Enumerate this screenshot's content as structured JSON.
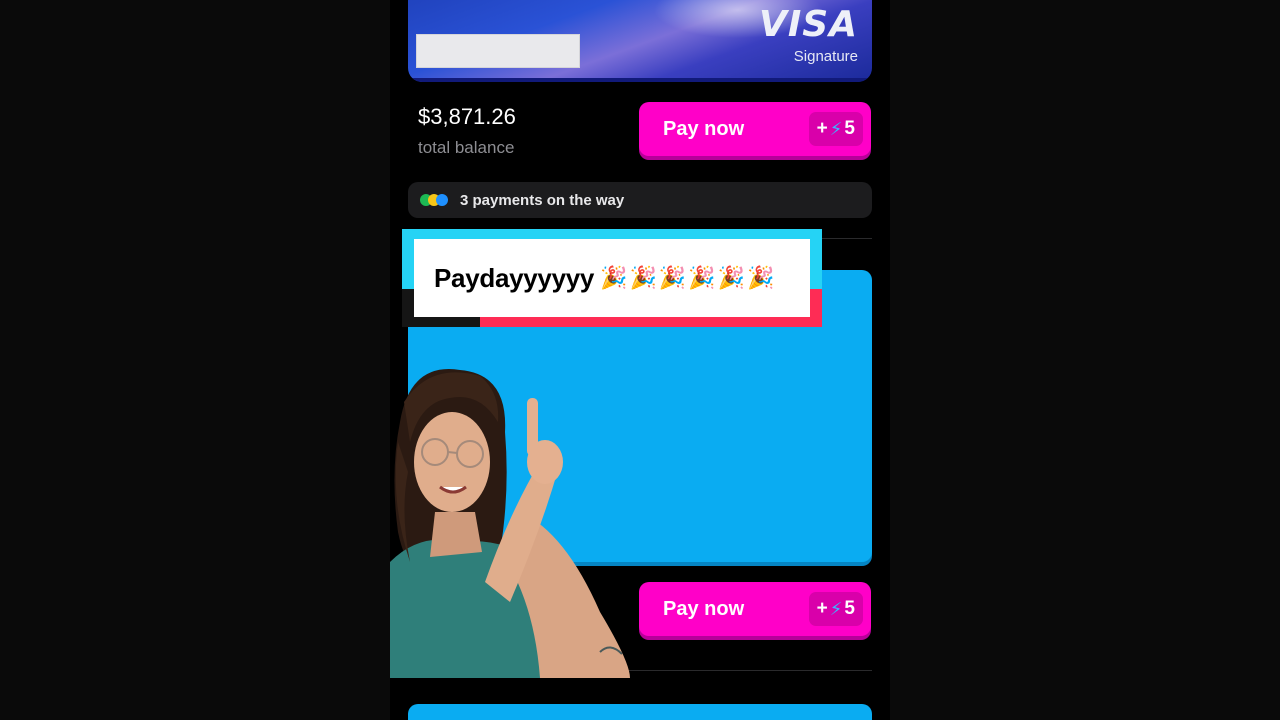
{
  "card": {
    "brand": "VISA",
    "brand_sub": "Signature"
  },
  "balance": {
    "amount": "$3,871.26",
    "label": "total balance"
  },
  "pay_buttons": [
    {
      "label": "Pay now",
      "reward_prefix": "+",
      "reward_icon": "lightning-bolt-icon",
      "reward_value": "5"
    },
    {
      "label": "Pay now",
      "reward_prefix": "+",
      "reward_icon": "lightning-bolt-icon",
      "reward_value": "5"
    }
  ],
  "payments_status": {
    "text": "3 payments on the way",
    "dot_colors": [
      "#1db954",
      "#f5c518",
      "#1e90ff"
    ]
  },
  "caption": {
    "text": "Paydayyyyyy",
    "emoji": "🎉🎉🎉🎉🎉🎉"
  },
  "colors": {
    "pay_button": "#ff00c8",
    "panel_blue": "#0aacf2",
    "caption_cyan": "#25d3f5",
    "caption_red": "#fe2c55"
  }
}
